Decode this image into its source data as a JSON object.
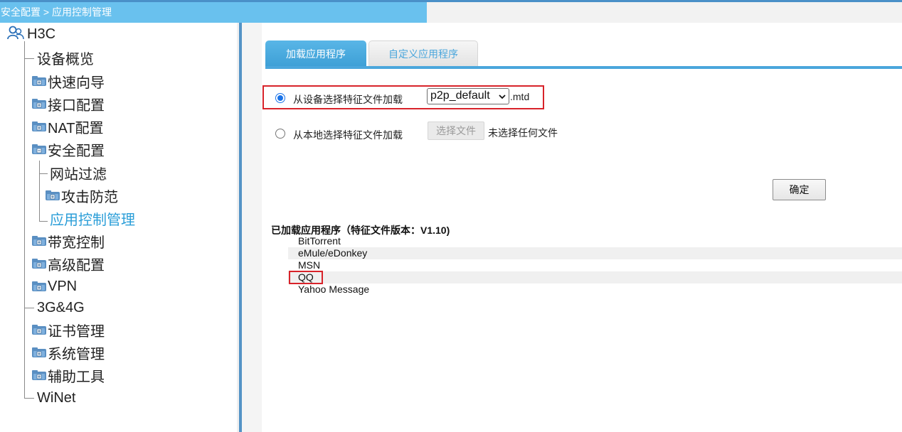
{
  "breadcrumb": "安全配置 > 应用控制管理",
  "sidebar": {
    "root": "H3C",
    "items": [
      {
        "label": "设备概览",
        "expandable": false,
        "active": false
      },
      {
        "label": "快速向导",
        "expandable": true,
        "active": false
      },
      {
        "label": "接口配置",
        "expandable": true,
        "active": false
      },
      {
        "label": "NAT配置",
        "expandable": true,
        "active": false
      },
      {
        "label": "安全配置",
        "expandable": true,
        "expanded": true,
        "active": false
      },
      {
        "label": "网站过滤",
        "expandable": false,
        "active": false
      },
      {
        "label": "攻击防范",
        "expandable": true,
        "active": false
      },
      {
        "label": "应用控制管理",
        "expandable": false,
        "active": true
      },
      {
        "label": "带宽控制",
        "expandable": true,
        "active": false
      },
      {
        "label": "高级配置",
        "expandable": true,
        "active": false
      },
      {
        "label": "VPN",
        "expandable": true,
        "active": false
      },
      {
        "label": "3G&4G",
        "expandable": false,
        "active": false
      },
      {
        "label": "证书管理",
        "expandable": true,
        "active": false
      },
      {
        "label": "系统管理",
        "expandable": true,
        "active": false
      },
      {
        "label": "辅助工具",
        "expandable": true,
        "active": false
      },
      {
        "label": "WiNet",
        "expandable": false,
        "active": false
      }
    ]
  },
  "tabs": [
    {
      "label": "加载应用程序",
      "active": true
    },
    {
      "label": "自定义应用程序",
      "active": false
    }
  ],
  "options": {
    "device": {
      "label": "从设备选择特征文件加载",
      "checked": true,
      "selected_file": "p2p_default",
      "extension": ".mtd"
    },
    "local": {
      "label": "从本地选择特征文件加载",
      "checked": false,
      "choose_button": "选择文件",
      "status": "未选择任何文件"
    }
  },
  "confirm_button": "确定",
  "loaded": {
    "title": "已加载应用程序（特征文件版本：V1.10)",
    "apps": [
      "BitTorrent",
      "eMule/eDonkey",
      "MSN",
      "QQ",
      "Yahoo Message"
    ]
  },
  "colors": {
    "accent": "#69c1ee",
    "tab_active": "#3d9fd6",
    "active_link": "#2b9ed8",
    "highlight_box": "#d8232a"
  }
}
